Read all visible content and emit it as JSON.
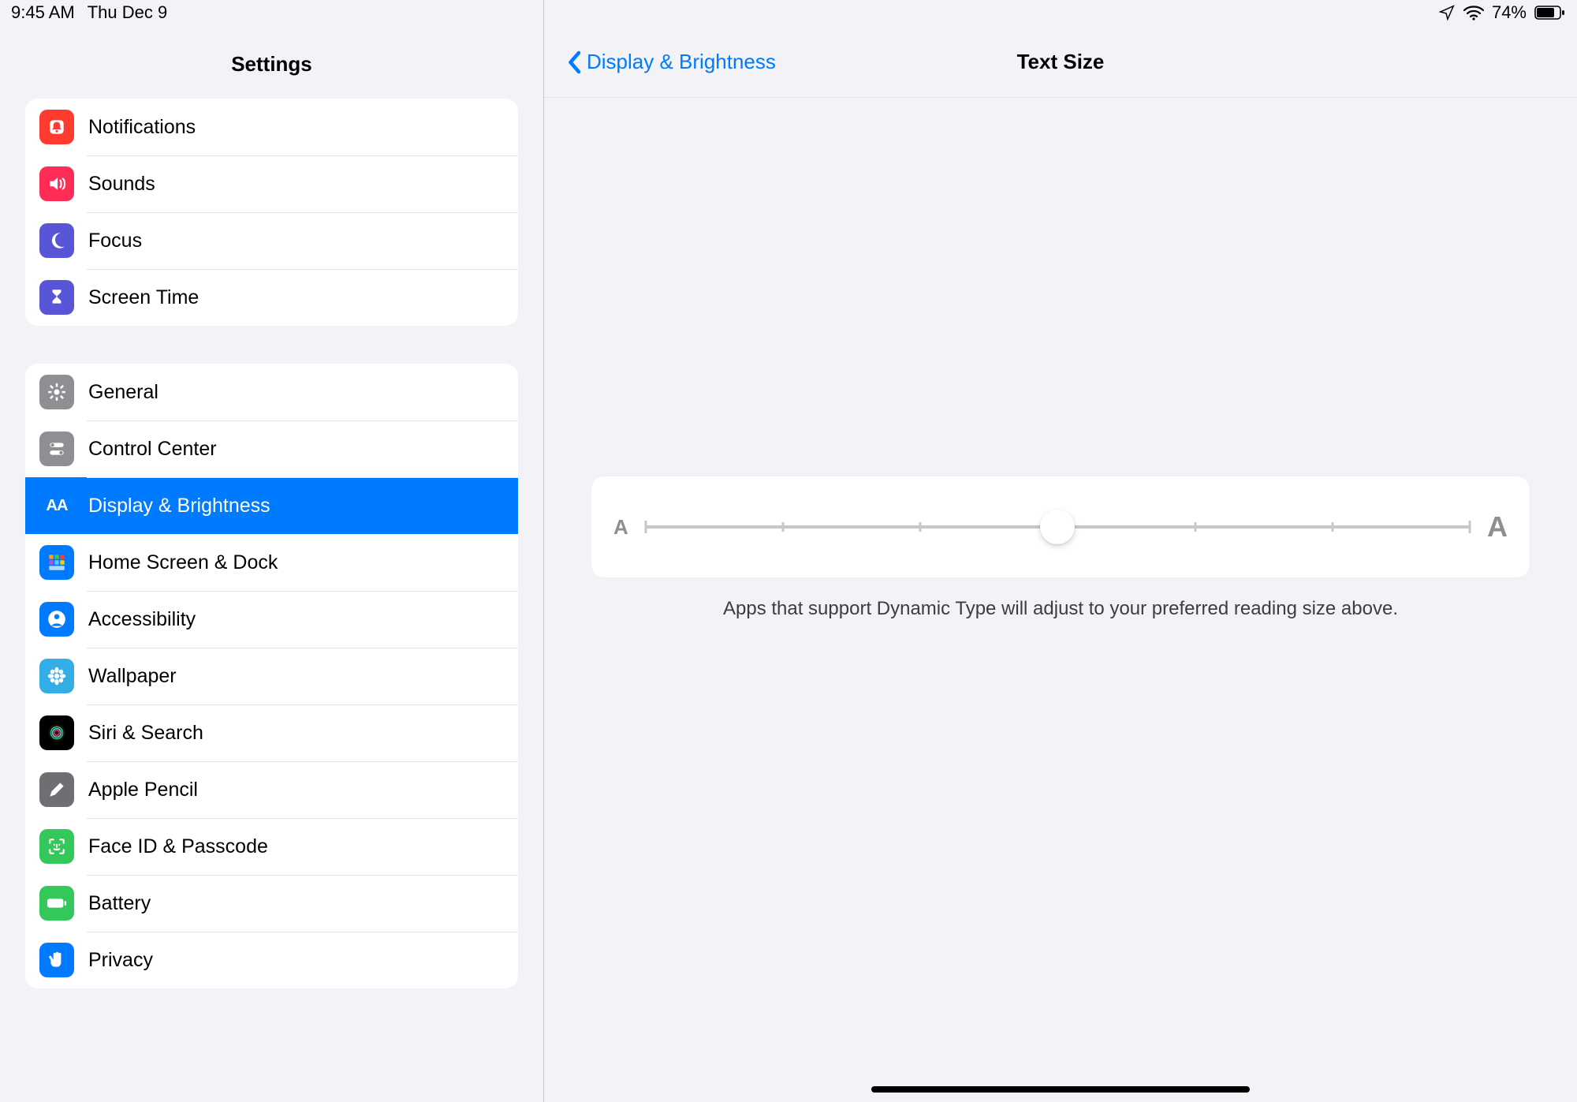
{
  "status": {
    "time": "9:45 AM",
    "date": "Thu Dec 9",
    "battery_pct": "74%"
  },
  "sidebar": {
    "title": "Settings",
    "groups": [
      {
        "items": [
          {
            "label": "Notifications",
            "icon": "bell-icon",
            "color": "bg-red"
          },
          {
            "label": "Sounds",
            "icon": "speaker-icon",
            "color": "bg-pink"
          },
          {
            "label": "Focus",
            "icon": "moon-icon",
            "color": "bg-indigo"
          },
          {
            "label": "Screen Time",
            "icon": "hourglass-icon",
            "color": "bg-indigo"
          }
        ]
      },
      {
        "items": [
          {
            "label": "General",
            "icon": "gear-icon",
            "color": "bg-gray"
          },
          {
            "label": "Control Center",
            "icon": "switches-icon",
            "color": "bg-gray"
          },
          {
            "label": "Display & Brightness",
            "icon": "aa-icon",
            "color": "bg-blue",
            "selected": true
          },
          {
            "label": "Home Screen & Dock",
            "icon": "grid-icon",
            "color": "bg-blue"
          },
          {
            "label": "Accessibility",
            "icon": "person-icon",
            "color": "bg-blue"
          },
          {
            "label": "Wallpaper",
            "icon": "flower-icon",
            "color": "bg-cyan"
          },
          {
            "label": "Siri & Search",
            "icon": "siri-icon",
            "color": "bg-black"
          },
          {
            "label": "Apple Pencil",
            "icon": "pencil-icon",
            "color": "bg-darkgray"
          },
          {
            "label": "Face ID & Passcode",
            "icon": "faceid-icon",
            "color": "bg-green"
          },
          {
            "label": "Battery",
            "icon": "battery-icon",
            "color": "bg-green"
          },
          {
            "label": "Privacy",
            "icon": "hand-icon",
            "color": "bg-blue"
          }
        ]
      }
    ]
  },
  "detail": {
    "back_label": "Display & Brightness",
    "title": "Text Size",
    "slider": {
      "small_label": "A",
      "large_label": "A",
      "steps": 7,
      "value_index": 3
    },
    "footnote": "Apps that support Dynamic Type will adjust to your preferred reading size above."
  }
}
